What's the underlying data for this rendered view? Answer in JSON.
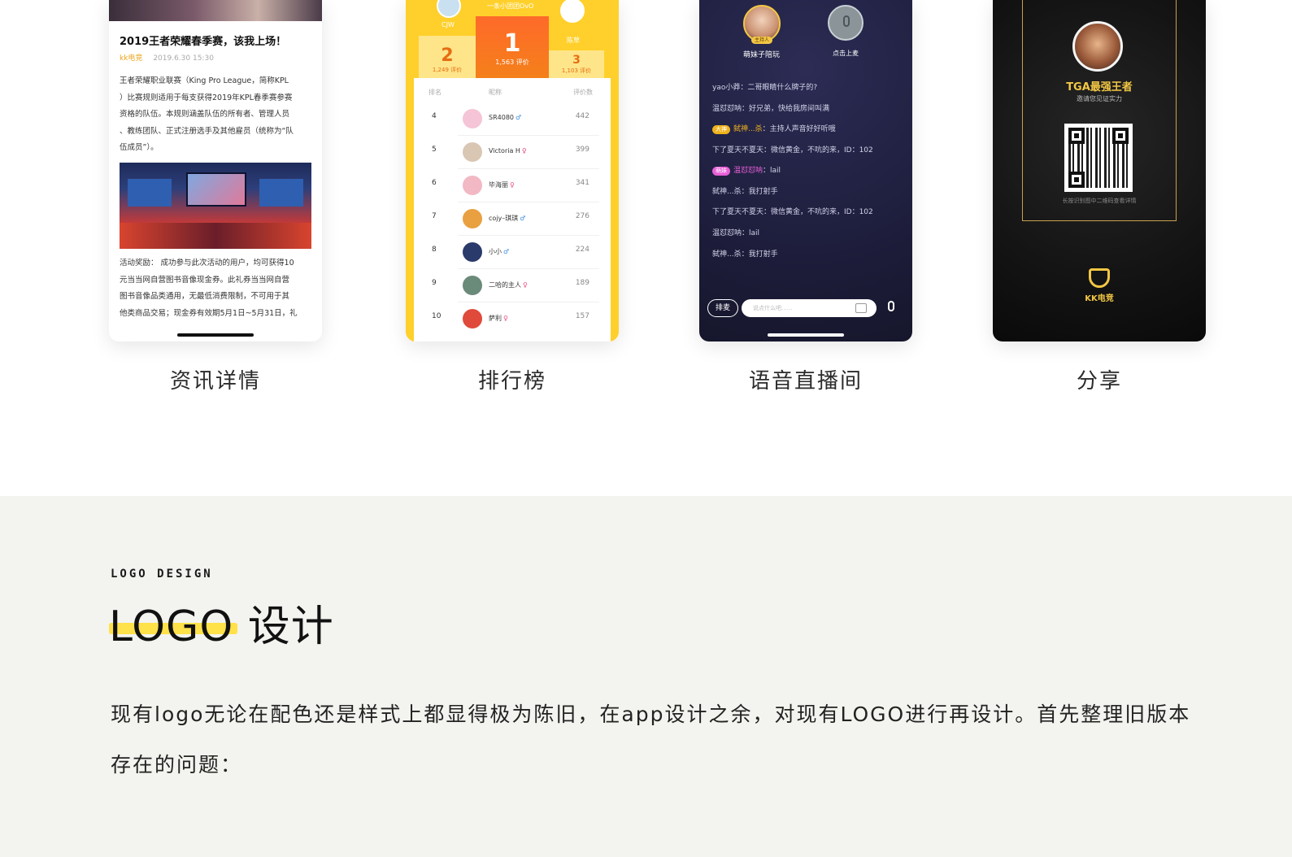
{
  "screens": {
    "news": {
      "caption": "资讯详情",
      "title": "2019王者荣耀春季赛，该我上场！",
      "source": "kk电竞",
      "date": "2019.6.30 15:30",
      "paragraph1": [
        "王者荣耀职业联赛（King Pro League，简称KPL",
        "）比赛规则适用于每支获得2019年KPL春季赛参赛",
        "资格的队伍。本规则涵盖队伍的所有者、管理人员",
        "、教练团队、正式注册选手及其他雇员（统称为“队",
        "伍成员”）。"
      ],
      "paragraph2": [
        "活动奖励： 成功参与此次活动的用户，均可获得10",
        "元当当网自营图书音像现金券。此礼券当当网自营",
        "图书音像品类通用，无最低消费限制，不可用于其",
        "他类商品交易；现金券有效期5月1日~5月31日，礼"
      ]
    },
    "ranking": {
      "caption": "排行榜",
      "team_name": "一条小团团OvO",
      "podium": {
        "first": {
          "rank": "1",
          "score": "1,563 评价"
        },
        "second": {
          "rank": "2",
          "score": "1,249 评价",
          "name": "CJW"
        },
        "third": {
          "rank": "3",
          "score": "1,103 评价",
          "name": "陈草"
        }
      },
      "columns": {
        "rank": "排名",
        "nickname": "昵称",
        "score": "评价数"
      },
      "rows": [
        {
          "rank": "4",
          "name": "SR4080",
          "sex": "♂",
          "score": "442"
        },
        {
          "rank": "5",
          "name": "Victoria H",
          "sex": "♀",
          "score": "399"
        },
        {
          "rank": "6",
          "name": "毕海丽",
          "sex": "♀",
          "score": "341"
        },
        {
          "rank": "7",
          "name": "cojy–琪琪",
          "sex": "♂",
          "score": "276"
        },
        {
          "rank": "8",
          "name": "小小",
          "sex": "♂",
          "score": "224"
        },
        {
          "rank": "9",
          "name": "二哈的主人",
          "sex": "♀",
          "score": "189"
        },
        {
          "rank": "10",
          "name": "萨利",
          "sex": "♀",
          "score": "157"
        }
      ]
    },
    "voice": {
      "caption": "语音直播间",
      "host_name": "萌妹子陪玩",
      "host_tag": "主持人",
      "mic_label": "点击上麦",
      "messages": [
        {
          "badge": "",
          "user": "yao小莽",
          "text": "yao小莽：二哥眼睛什么牌子的?"
        },
        {
          "badge": "",
          "user": "温怼怼呐",
          "text": "温怼怼呐：好兄弟，快给我房间叫满"
        },
        {
          "badge": "大神",
          "user": "弑神...杀",
          "text": "：主持人声音好好听哦"
        },
        {
          "badge": "",
          "user": "下了夏天不夏天",
          "text": "下了夏天不夏天：微信黄金，不吭的来，ID：102"
        },
        {
          "badge": "萌妹",
          "user": "温怼怼呐",
          "text": "：lail"
        },
        {
          "badge": "",
          "user": "弑神...杀",
          "text": "弑神...杀：我打射手"
        },
        {
          "badge": "",
          "user": "下了夏天不夏天",
          "text": "下了夏天不夏天：微信黄金，不吭的来，ID：102"
        },
        {
          "badge": "",
          "user": "温怼怼呐",
          "text": "温怼怼呐：lail"
        },
        {
          "badge": "",
          "user": "弑神...杀",
          "text": "弑神...杀：我打射手"
        }
      ],
      "queue_label": "排麦",
      "input_placeholder": "说点什么吧......"
    },
    "share": {
      "caption": "分享",
      "title": "TGA最强王者",
      "subtitle": "邀请您见证实力",
      "qr_hint": "长按识别图中二维码查看详情",
      "brand": "KK电竞"
    }
  },
  "section": {
    "kicker": "LOGO DESIGN",
    "heading": "LOGO 设计",
    "body": "现有logo无论在配色还是样式上都显得极为陈旧，在app设计之余，对现有LOGO进行再设计。首先整理旧版本存在的问题：",
    "accent_color": "#ffe14a",
    "background_color": "#f3f3ef"
  }
}
